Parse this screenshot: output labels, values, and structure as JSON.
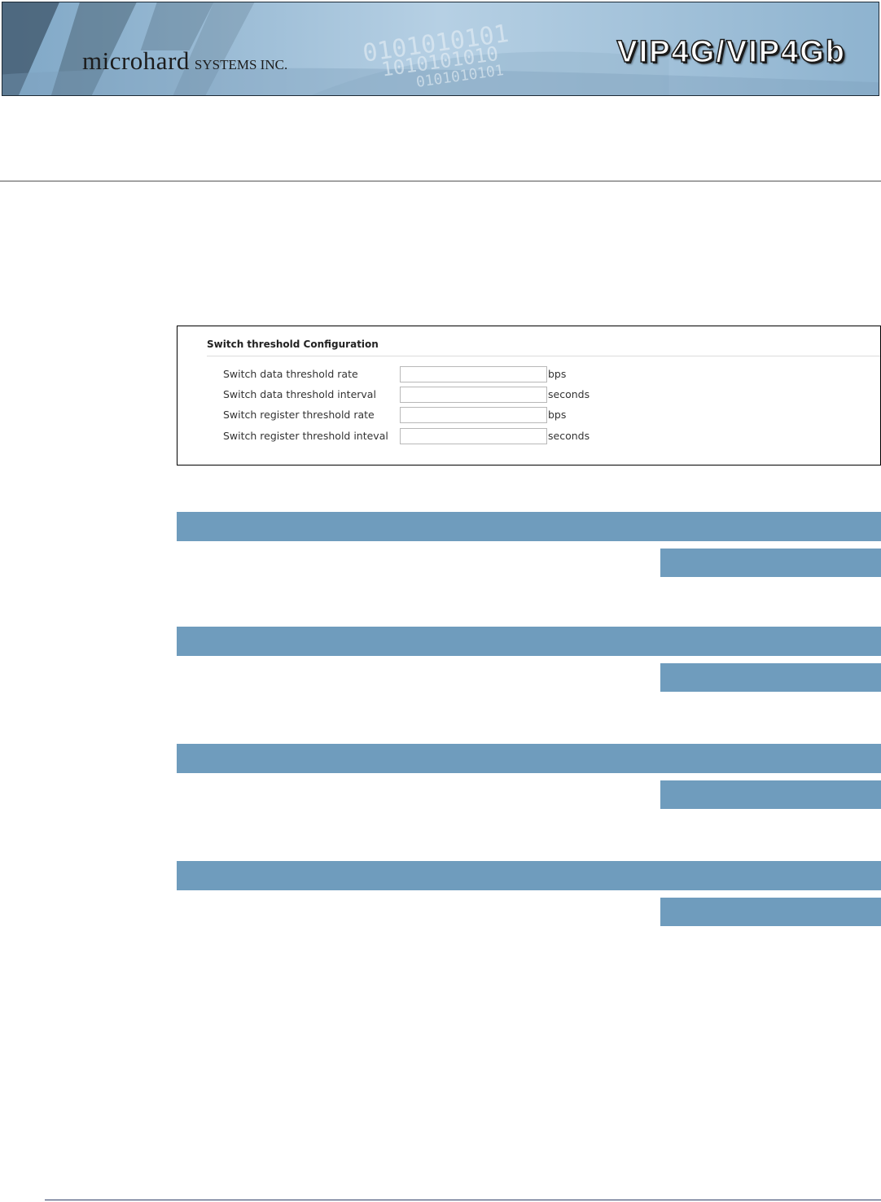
{
  "header": {
    "brand_main": "microhard",
    "brand_sub": "SYSTEMS INC.",
    "product": "VIP4G/VIP4Gb",
    "binary_decoration": [
      "0101010101",
      "1010101010",
      "0101010101"
    ]
  },
  "config_panel": {
    "title": "Switch threshold Configuration",
    "fields": [
      {
        "label": "Switch data threshold rate",
        "value": "",
        "unit": "bps"
      },
      {
        "label": "Switch data threshold interval",
        "value": "",
        "unit": "seconds"
      },
      {
        "label": "Switch register threshold rate",
        "value": "",
        "unit": "bps"
      },
      {
        "label": "Switch register threshold inteval",
        "value": "",
        "unit": "seconds"
      }
    ]
  },
  "colors": {
    "bar_blue": "#6f9cbd",
    "banner_blue": "#9cc0da",
    "rule_navy": "#2e3d66"
  }
}
